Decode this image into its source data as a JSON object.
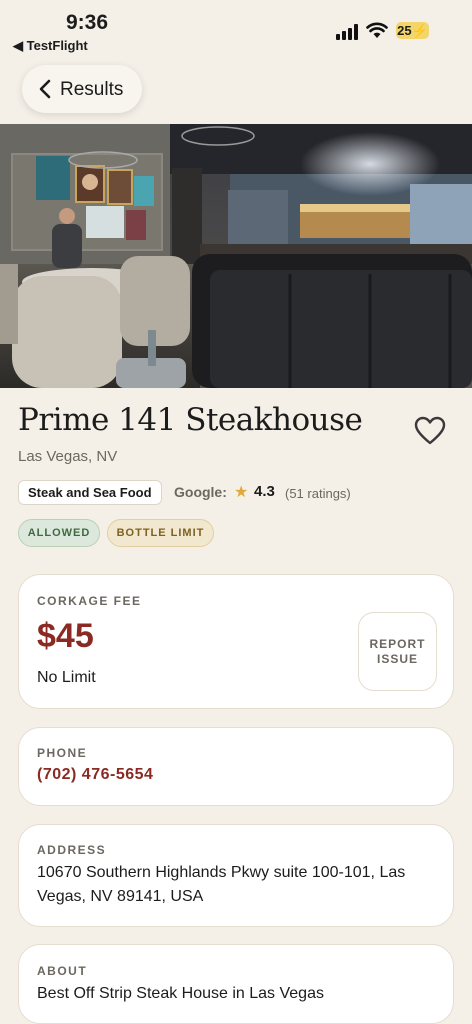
{
  "status_bar": {
    "time": "9:36",
    "back_app": "◀ TestFlight",
    "battery": "25"
  },
  "nav": {
    "back_label": "Results"
  },
  "restaurant": {
    "name": "Prime 141 Steakhouse",
    "location": "Las Vegas, NV",
    "cuisine": "Steak and Sea Food",
    "rating_source": "Google:",
    "rating": "4.3",
    "ratings_count": "(51 ratings)",
    "badges": [
      "ALLOWED",
      "BOTTLE LIMIT"
    ]
  },
  "corkage": {
    "label": "CORKAGE FEE",
    "fee": "$45",
    "limit": "No Limit",
    "report_button": "REPORT ISSUE"
  },
  "phone": {
    "label": "PHONE",
    "value": "(702) 476-5654"
  },
  "address": {
    "label": "ADDRESS",
    "value": "10670 Southern Highlands Pkwy suite 100-101, Las Vegas, NV 89141, USA"
  },
  "about": {
    "label": "ABOUT",
    "value": "Best Off Strip Steak House in Las Vegas"
  },
  "colors": {
    "background": "#f4f0e8",
    "accent_red": "#8a2a23",
    "allowed_green": "#3f6a41",
    "bottle_gold": "#7c6222",
    "star": "#e1a93a"
  }
}
